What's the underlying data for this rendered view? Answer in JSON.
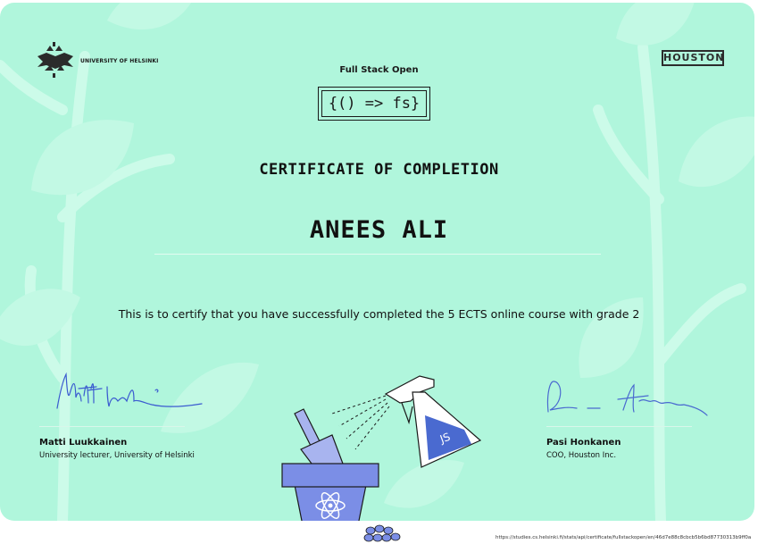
{
  "university": {
    "name": "UNIVERSITY OF HELSINKI"
  },
  "partner": {
    "name": "HOUSTON"
  },
  "course": {
    "title": "Full Stack Open",
    "logo_text": "{() => fs}"
  },
  "certificate": {
    "heading": "CERTIFICATE OF COMPLETION",
    "recipient": "ANEES ALI",
    "statement": "This is to certify that you have successfully completed the 5 ECTS online course with grade 2"
  },
  "signatures": [
    {
      "name": "Matti Luukkainen",
      "title": "University lecturer, University of Helsinki"
    },
    {
      "name": "Pasi Honkanen",
      "title": "COO, Houston Inc."
    }
  ],
  "illustration": {
    "bottle_label": "JS"
  },
  "footer": {
    "url": "https://studies.cs.helsinki.fi/stats/api/certificate/fullstackopen/en/46d7e88c8cbcb5b6bd87730313b9ff0a"
  },
  "colors": {
    "background": "#b0f6dc",
    "pot": "#7b8ee6",
    "pot_light": "#a8b4ef",
    "ink": "#4a6ad0"
  }
}
